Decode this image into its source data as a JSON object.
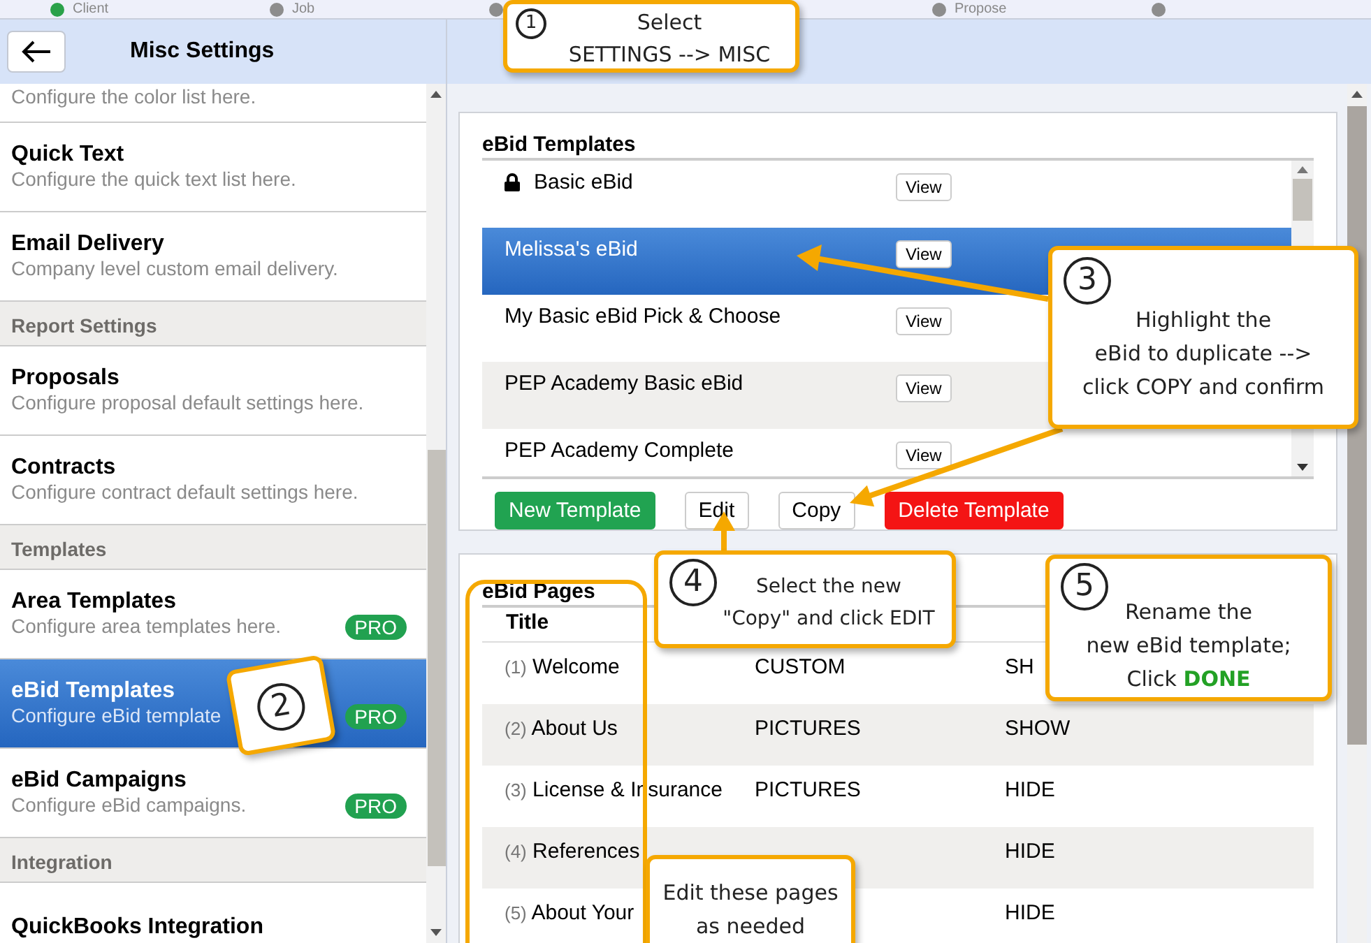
{
  "stepper": [
    {
      "label": "Client",
      "done": true
    },
    {
      "label": "Job",
      "done": false
    },
    {
      "done": false
    },
    {
      "label": "Propose",
      "done": false
    },
    {
      "done": false
    }
  ],
  "sidebar": {
    "title": "Misc Settings",
    "items": [
      {
        "kind": "item",
        "description": "Configure the color list here.",
        "selected": false,
        "pro": false
      },
      {
        "kind": "item",
        "title": "Quick Text",
        "description": "Configure the quick text list here.",
        "selected": false,
        "pro": false
      },
      {
        "kind": "item",
        "title": "Email Delivery",
        "description": "Company level custom email delivery.",
        "selected": false,
        "pro": false
      },
      {
        "kind": "header",
        "title": "Report Settings"
      },
      {
        "kind": "item",
        "title": "Proposals",
        "description": "Configure proposal default settings here.",
        "selected": false,
        "pro": false
      },
      {
        "kind": "item",
        "title": "Contracts",
        "description": "Configure contract default settings here.",
        "selected": false,
        "pro": false
      },
      {
        "kind": "header",
        "title": "Templates"
      },
      {
        "kind": "item",
        "title": "Area Templates",
        "description": "Configure area templates here.",
        "selected": false,
        "pro": true,
        "badge": "PRO"
      },
      {
        "kind": "item",
        "title": "eBid Templates",
        "description": "Configure eBid template",
        "selected": true,
        "pro": true,
        "badge": "PRO"
      },
      {
        "kind": "item",
        "title": "eBid Campaigns",
        "description": "Configure eBid campaigns.",
        "selected": false,
        "pro": true,
        "badge": "PRO"
      },
      {
        "kind": "header",
        "title": "Integration"
      },
      {
        "kind": "item",
        "title": "QuickBooks Integration",
        "selected": false,
        "pro": false
      }
    ]
  },
  "templates": {
    "title": "eBid Templates",
    "rows": [
      {
        "name": "Basic eBid",
        "locked": true,
        "selected": false,
        "button": "View"
      },
      {
        "name": "Melissa's eBid",
        "locked": false,
        "selected": true,
        "button": "View"
      },
      {
        "name": "My Basic eBid Pick & Choose",
        "locked": false,
        "selected": false,
        "button": "View"
      },
      {
        "name": "PEP Academy Basic eBid",
        "locked": false,
        "selected": false,
        "button": "View"
      },
      {
        "name": "PEP Academy Complete",
        "locked": false,
        "selected": false,
        "button": "View"
      }
    ],
    "buttons": [
      {
        "label": "New Template",
        "kind": "primary"
      },
      {
        "label": "Edit",
        "kind": "plain"
      },
      {
        "label": "Copy",
        "kind": "plain"
      },
      {
        "label": "Delete Template",
        "kind": "danger"
      }
    ]
  },
  "pages": {
    "title": "eBid Pages",
    "columns": [
      "Title"
    ],
    "rows": [
      {
        "number": "(1)",
        "title": "Welcome",
        "type": "CUSTOM",
        "visibility": "SH"
      },
      {
        "number": "(2)",
        "title": "About Us",
        "type": "PICTURES",
        "visibility": "SHOW"
      },
      {
        "number": "(3)",
        "title": "License & Insurance",
        "type": "PICTURES",
        "visibility": "HIDE"
      },
      {
        "number": "(4)",
        "title": "References",
        "type": "",
        "visibility": "HIDE"
      },
      {
        "number": "(5)",
        "title": "About Your",
        "type": "",
        "visibility": "HIDE"
      }
    ]
  },
  "callouts": [
    {
      "step": "1",
      "text": "Select\nSETTINGS --> MISC"
    },
    {
      "step": "2"
    },
    {
      "step": "3",
      "text": "Highlight the\neBid to duplicate -->\nclick COPY and confirm"
    },
    {
      "step": "4",
      "text": "Select the new\n\"Copy\" and click EDIT"
    },
    {
      "step": "5",
      "text": "Rename the\nnew eBid template;\nClick **DONE**"
    },
    {
      "text": "Edit these pages\nas needed"
    }
  ]
}
